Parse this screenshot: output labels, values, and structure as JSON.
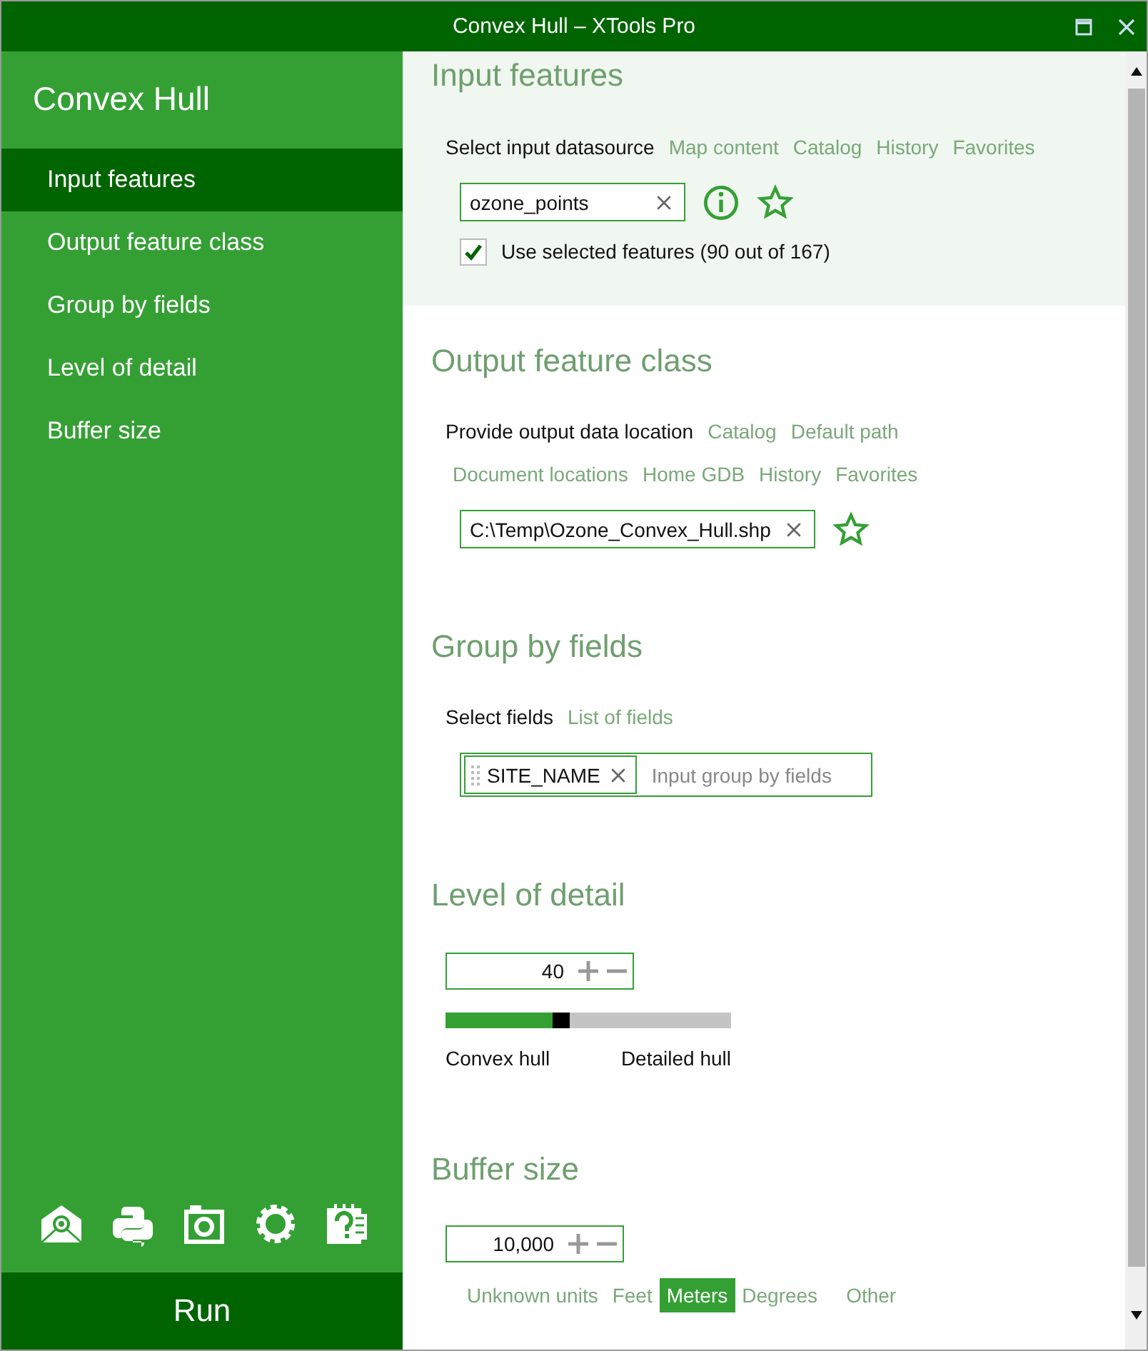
{
  "window": {
    "title": "Convex Hull – XTools Pro"
  },
  "sidebar": {
    "title": "Convex Hull",
    "items": [
      {
        "label": "Input features",
        "selected": true
      },
      {
        "label": "Output feature class",
        "selected": false
      },
      {
        "label": "Group by fields",
        "selected": false
      },
      {
        "label": "Level of detail",
        "selected": false
      },
      {
        "label": "Buffer size",
        "selected": false
      }
    ],
    "run_button": "Run"
  },
  "input_features": {
    "title": "Input features",
    "prompt": "Select input datasource",
    "links": [
      "Map content",
      "Catalog",
      "History",
      "Favorites"
    ],
    "value": "ozone_points",
    "use_selected": {
      "label": "Use selected features (90 out of 167)",
      "checked": true
    }
  },
  "output_feature_class": {
    "title": "Output feature class",
    "prompt": "Provide output data location",
    "links": [
      "Catalog",
      "Default path"
    ],
    "more_links": [
      "Document locations",
      "Home GDB",
      "History",
      "Favorites"
    ],
    "value": "C:\\Temp\\Ozone_Convex_Hull.shp"
  },
  "group_by_fields": {
    "title": "Group by fields",
    "prompt": "Select fields",
    "links": [
      "List of fields"
    ],
    "tags": [
      "SITE_NAME"
    ],
    "placeholder": "Input group by fields"
  },
  "level_of_detail": {
    "title": "Level of detail",
    "value": "40",
    "level": 0.375,
    "min_label": "Convex hull",
    "max_label": "Detailed hull"
  },
  "buffer_size": {
    "title": "Buffer size",
    "value": "10,000",
    "units": [
      {
        "label": "Unknown units",
        "selected": false
      },
      {
        "label": "Feet",
        "selected": false
      },
      {
        "label": "Meters",
        "selected": true
      },
      {
        "label": "Degrees",
        "selected": false
      },
      {
        "label": "Other",
        "selected": false
      }
    ]
  }
}
